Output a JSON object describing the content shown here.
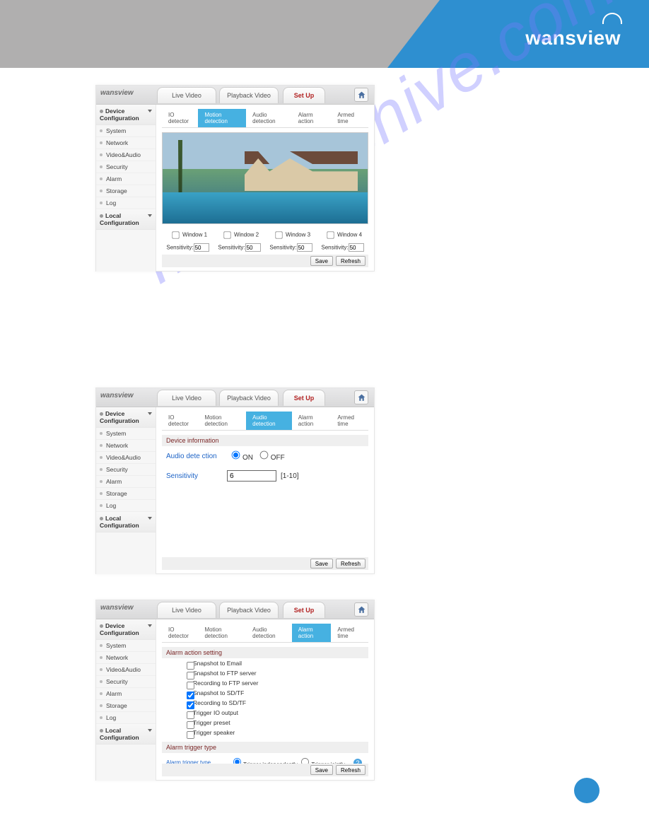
{
  "brand": "wansview",
  "watermark": "manualshive.com",
  "header": {
    "tabs": [
      "Live Video",
      "Playback Video",
      "Set Up"
    ],
    "active": 2
  },
  "side": {
    "group1": "Device Configuration",
    "items": [
      "System",
      "Network",
      "Video&Audio",
      "Security",
      "Alarm",
      "Storage",
      "Log"
    ],
    "group2": "Local Configuration"
  },
  "subtabs": [
    "IO detector",
    "Motion detection",
    "Audio detection",
    "Alarm action",
    "Armed time"
  ],
  "panel1": {
    "activeSub": 1,
    "windows": [
      "Window 1",
      "Window 2",
      "Window 3",
      "Window 4"
    ],
    "sensLabel": "Sensitivity:",
    "sensValue": "50"
  },
  "panel2": {
    "activeSub": 2,
    "section": "Device information",
    "audioLabel": "Audio dete ction",
    "on": "ON",
    "off": "OFF",
    "sensLabel": "Sensitivity",
    "sensValue": "6",
    "sensHint": "[1-10]"
  },
  "panel3": {
    "activeSub": 3,
    "section1": "Alarm action setting",
    "checks": [
      {
        "label": "Snapshot to Email",
        "checked": false
      },
      {
        "label": "Snapshot to FTP server",
        "checked": false
      },
      {
        "label": "Recording to FTP server",
        "checked": false
      },
      {
        "label": "Snapshot to SD/TF",
        "checked": true
      },
      {
        "label": "Recording to SD/TF",
        "checked": true
      },
      {
        "label": "Trigger IO output",
        "checked": false
      },
      {
        "label": "Trigger preset",
        "checked": false
      },
      {
        "label": "Trigger speaker",
        "checked": false
      }
    ],
    "section2": "Alarm trigger type",
    "trigLabel": "Alarm trigger type",
    "trigOpts": [
      "Trigger independently",
      "Trigger jointly"
    ]
  },
  "buttons": {
    "save": "Save",
    "refresh": "Refresh"
  }
}
